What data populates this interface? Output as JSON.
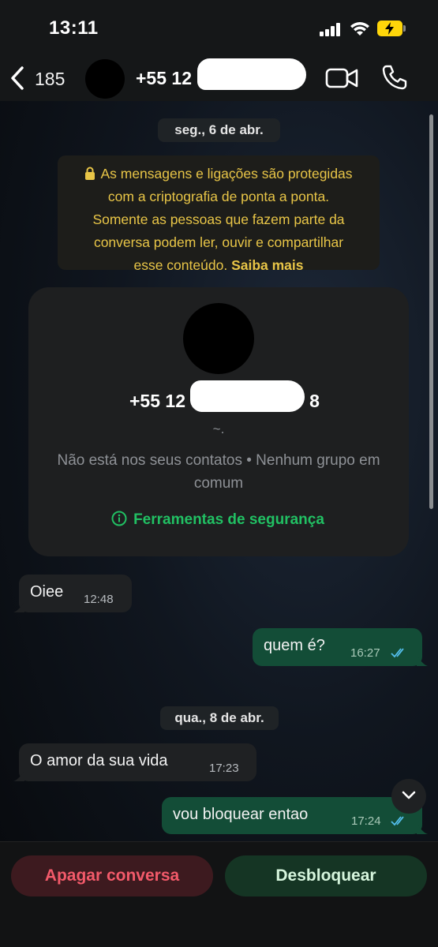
{
  "status_bar": {
    "time": "13:11"
  },
  "header": {
    "back_count": "185",
    "contact_name": "+55 12 9"
  },
  "chat": {
    "dates": [
      {
        "label": "seg., 6 de abr."
      },
      {
        "label": "qua., 8 de abr."
      }
    ],
    "encryption_notice": {
      "line1": "As mensagens e ligações são protegidas",
      "line2": "com a criptografia de ponta a ponta.",
      "line3": "Somente as pessoas que fazem parte da",
      "line4": "conversa podem ler, ouvir e compartilhar",
      "line5": "esse conteúdo.",
      "link": "Saiba mais"
    },
    "contact_card": {
      "number": "+55 12 9",
      "number_end": "8",
      "status": "~.",
      "description": "Não está nos seus contatos • Nenhum grupo em comum",
      "security_link": "Ferramentas de segurança"
    },
    "messages": [
      {
        "direction": "in",
        "text": "Oiee",
        "time": "12:48"
      },
      {
        "direction": "out",
        "text": "quem é?",
        "time": "16:27"
      },
      {
        "direction": "in",
        "text": "O amor da sua vida",
        "time": "17:23"
      },
      {
        "direction": "out",
        "text": "vou bloquear entao",
        "time": "17:24"
      }
    ]
  },
  "actions": {
    "delete_label": "Apagar conversa",
    "unblock_label": "Desbloquear"
  },
  "colors": {
    "accent_green": "#21c063",
    "notice_yellow": "#e8c547",
    "outgoing_bubble": "#134d37",
    "incoming_bubble": "#1f2123",
    "delete_red": "#f35a6a",
    "read_tick": "#53bdeb"
  },
  "icons": [
    "signal-icon",
    "wifi-icon",
    "battery-charging-icon",
    "chevron-left-icon",
    "video-call-icon",
    "phone-icon",
    "lock-icon",
    "info-icon",
    "double-check-icon",
    "chevron-down-icon"
  ]
}
